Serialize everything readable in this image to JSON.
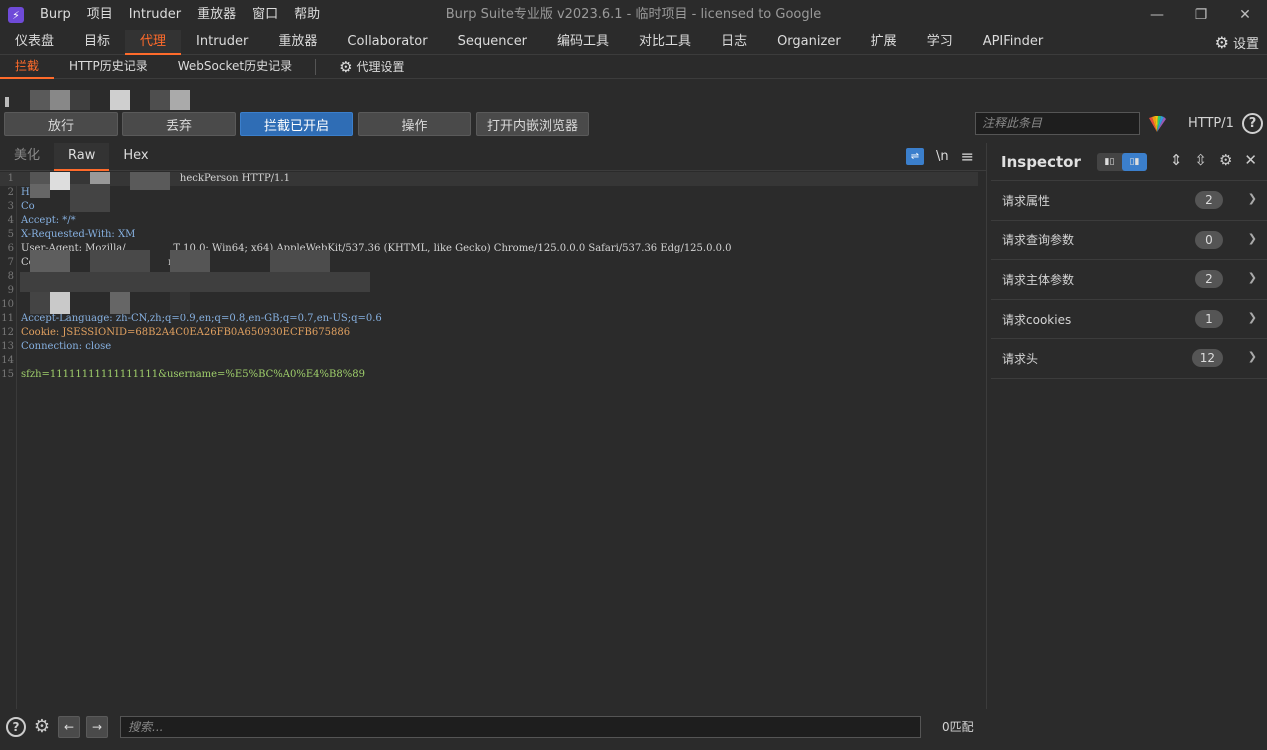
{
  "titlebar": {
    "logo_glyph": "⚡",
    "menus": [
      "Burp",
      "项目",
      "Intruder",
      "重放器",
      "窗口",
      "帮助"
    ],
    "title": "Burp Suite专业版  v2023.6.1 - 临时项目 - licensed to Google",
    "minimize": "—",
    "restore": "❐",
    "close": "✕"
  },
  "main_tabs": [
    "仪表盘",
    "目标",
    "代理",
    "Intruder",
    "重放器",
    "Collaborator",
    "Sequencer",
    "编码工具",
    "对比工具",
    "日志",
    "Organizer",
    "扩展",
    "学习",
    "APIFinder"
  ],
  "active_main_tab": "代理",
  "settings_label": "设置",
  "sub_tabs": [
    "拦截",
    "HTTP历史记录",
    "WebSocket历史记录"
  ],
  "proxy_settings_label": "代理设置",
  "toolbar": {
    "forward": "放行",
    "drop": "丢弃",
    "intercept_on": "拦截已开启",
    "action": "操作",
    "open_browser": "打开内嵌浏览器",
    "comment_placeholder": "注释此条目",
    "http_version": "HTTP/1",
    "help": "?"
  },
  "editor": {
    "tabs": [
      "美化",
      "Raw",
      "Hex"
    ],
    "active_tab": "Raw",
    "wrap_icon": "⇌",
    "newline_toggle": "\\n",
    "menu_icon": "≡",
    "lines": [
      {
        "n": "1",
        "text": "                                                  heckPerson HTTP/1.1"
      },
      {
        "n": "2",
        "text": "Ho"
      },
      {
        "n": "3",
        "text": "Co"
      },
      {
        "n": "4",
        "text": "Accept: */*"
      },
      {
        "n": "5",
        "text": "X-Requested-With: XM"
      },
      {
        "n": "6",
        "text": "User-Agent: Mozilla/               T 10.0; Win64; x64) AppleWebKit/537.36 (KHTML, like Gecko) Chrome/125.0.0.0 Safari/537.36 Edg/125.0.0.0"
      },
      {
        "n": "7",
        "text": "Co                                          rlen"
      },
      {
        "n": "8",
        "text": ""
      },
      {
        "n": "9",
        "text": ""
      },
      {
        "n": "10",
        "text": ""
      },
      {
        "n": "11",
        "text": "Accept-Language: zh-CN,zh;q=0.9,en;q=0.8,en-GB;q=0.7,en-US;q=0.6"
      },
      {
        "n": "12",
        "text": "Cookie: JSESSIONID=68B2A4C0EA26FB0A650930ECFB675886"
      },
      {
        "n": "13",
        "text": "Connection: close"
      },
      {
        "n": "14",
        "text": ""
      },
      {
        "n": "15",
        "text": "sfzh=11111111111111111&username=%E5%BC%A0%E4%B8%89"
      }
    ]
  },
  "inspector": {
    "title": "Inspector",
    "sections": [
      {
        "label": "请求属性",
        "count": "2"
      },
      {
        "label": "请求查询参数",
        "count": "0"
      },
      {
        "label": "请求主体参数",
        "count": "2"
      },
      {
        "label": "请求cookies",
        "count": "1"
      },
      {
        "label": "请求头",
        "count": "12"
      }
    ]
  },
  "bottom": {
    "search_placeholder": "搜索...",
    "match_count": "0匹配",
    "back": "←",
    "forward": "→"
  }
}
